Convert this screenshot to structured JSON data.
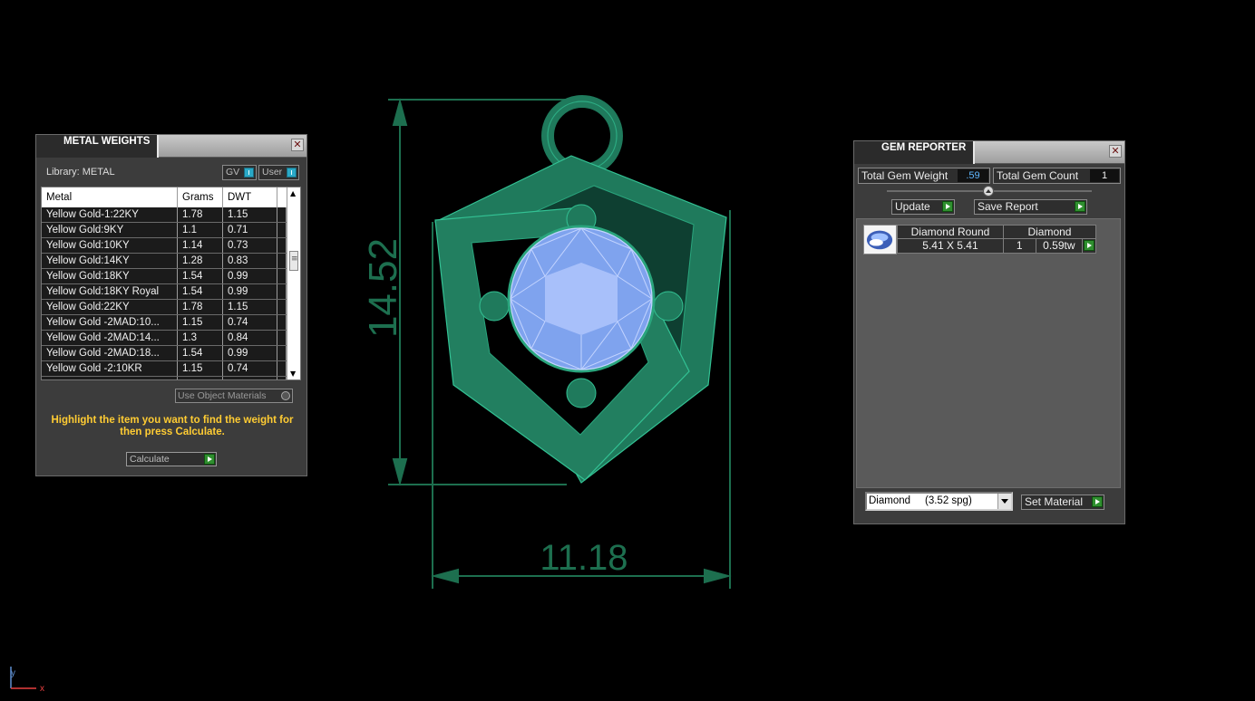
{
  "viewport": {
    "dimension_height": "14.52",
    "dimension_width": "11.18",
    "axis_x": "x",
    "axis_y": "y",
    "colors": {
      "background": "#000000",
      "metal": "#1f7a5c",
      "metal_edge": "#33c294",
      "gem": "#8fb0ff",
      "dimension": "#1d6f4f"
    }
  },
  "metal_weights": {
    "title": "METAL WEIGHTS",
    "library_label": "Library: METAL",
    "toggle_gv": "GV",
    "toggle_user": "User",
    "columns": [
      "Metal",
      "Grams",
      "DWT"
    ],
    "rows": [
      {
        "metal": "Yellow Gold-1:22KY",
        "grams": "1.78",
        "dwt": "1.15"
      },
      {
        "metal": "Yellow Gold:9KY",
        "grams": "1.1",
        "dwt": "0.71"
      },
      {
        "metal": "Yellow Gold:10KY",
        "grams": "1.14",
        "dwt": "0.73"
      },
      {
        "metal": "Yellow Gold:14KY",
        "grams": "1.28",
        "dwt": "0.83"
      },
      {
        "metal": "Yellow Gold:18KY",
        "grams": "1.54",
        "dwt": "0.99"
      },
      {
        "metal": "Yellow Gold:18KY Royal",
        "grams": "1.54",
        "dwt": "0.99"
      },
      {
        "metal": "Yellow Gold:22KY",
        "grams": "1.78",
        "dwt": "1.15"
      },
      {
        "metal": "Yellow Gold -2MAD:10...",
        "grams": "1.15",
        "dwt": "0.74"
      },
      {
        "metal": "Yellow Gold -2MAD:14...",
        "grams": "1.3",
        "dwt": "0.84"
      },
      {
        "metal": "Yellow Gold -2MAD:18...",
        "grams": "1.54",
        "dwt": "0.99"
      },
      {
        "metal": "Yellow Gold -2:10KR",
        "grams": "1.15",
        "dwt": "0.74"
      }
    ],
    "use_object_materials": "Use Object Materials",
    "hint": "Highlight the item you want to find the weight for then press Calculate.",
    "calculate_label": "Calculate"
  },
  "gem_reporter": {
    "title": "GEM REPORTER",
    "total_weight_label": "Total Gem Weight",
    "total_weight_value": ".59",
    "total_count_label": "Total Gem Count",
    "total_count_value": "1",
    "update_label": "Update",
    "save_report_label": "Save Report",
    "gem_row": {
      "name": "Diamond Round",
      "material": "Diamond",
      "size": "5.41 X 5.41",
      "count": "1",
      "weight": "0.59tw"
    },
    "material_select": "Diamond     (3.52 spg)",
    "set_material_label": "Set Material"
  }
}
